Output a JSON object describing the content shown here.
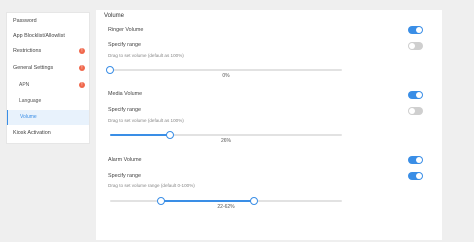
{
  "sidebar": {
    "items": [
      {
        "label": "Password",
        "badge": false
      },
      {
        "label": "App Blocklist/Allowlist",
        "badge": false
      },
      {
        "label": "Restrictions",
        "badge": true
      },
      {
        "label": "General Settings",
        "badge": true
      },
      {
        "label": "APN",
        "badge": true
      },
      {
        "label": "Language",
        "badge": false
      },
      {
        "label": "Volume",
        "badge": false,
        "active": true
      },
      {
        "label": "Kiosk Activation",
        "badge": false
      }
    ],
    "badge_text": "!"
  },
  "main": {
    "title": "Volume",
    "ringer": {
      "label": "Ringer Volume",
      "enabled": true,
      "range_label": "Specify range",
      "range_enabled": false,
      "hint": "Drag to set volume (default as 100%)",
      "value_text": "0%",
      "value": 0
    },
    "media": {
      "label": "Media Volume",
      "enabled": true,
      "range_label": "Specify range",
      "range_enabled": false,
      "hint": "Drag to set volume (default as 100%)",
      "value_text": "26%",
      "value": 26
    },
    "alarm": {
      "label": "Alarm Volume",
      "enabled": true,
      "range_label": "Specify range",
      "range_enabled": true,
      "hint": "Drag to set volume range (default 0-100%)",
      "value_text": "22-62%",
      "range_low": 22,
      "range_high": 62
    }
  },
  "colors": {
    "accent": "#3a8ee6",
    "badge": "#f0674b",
    "toggle_off": "#cfcfcf"
  }
}
